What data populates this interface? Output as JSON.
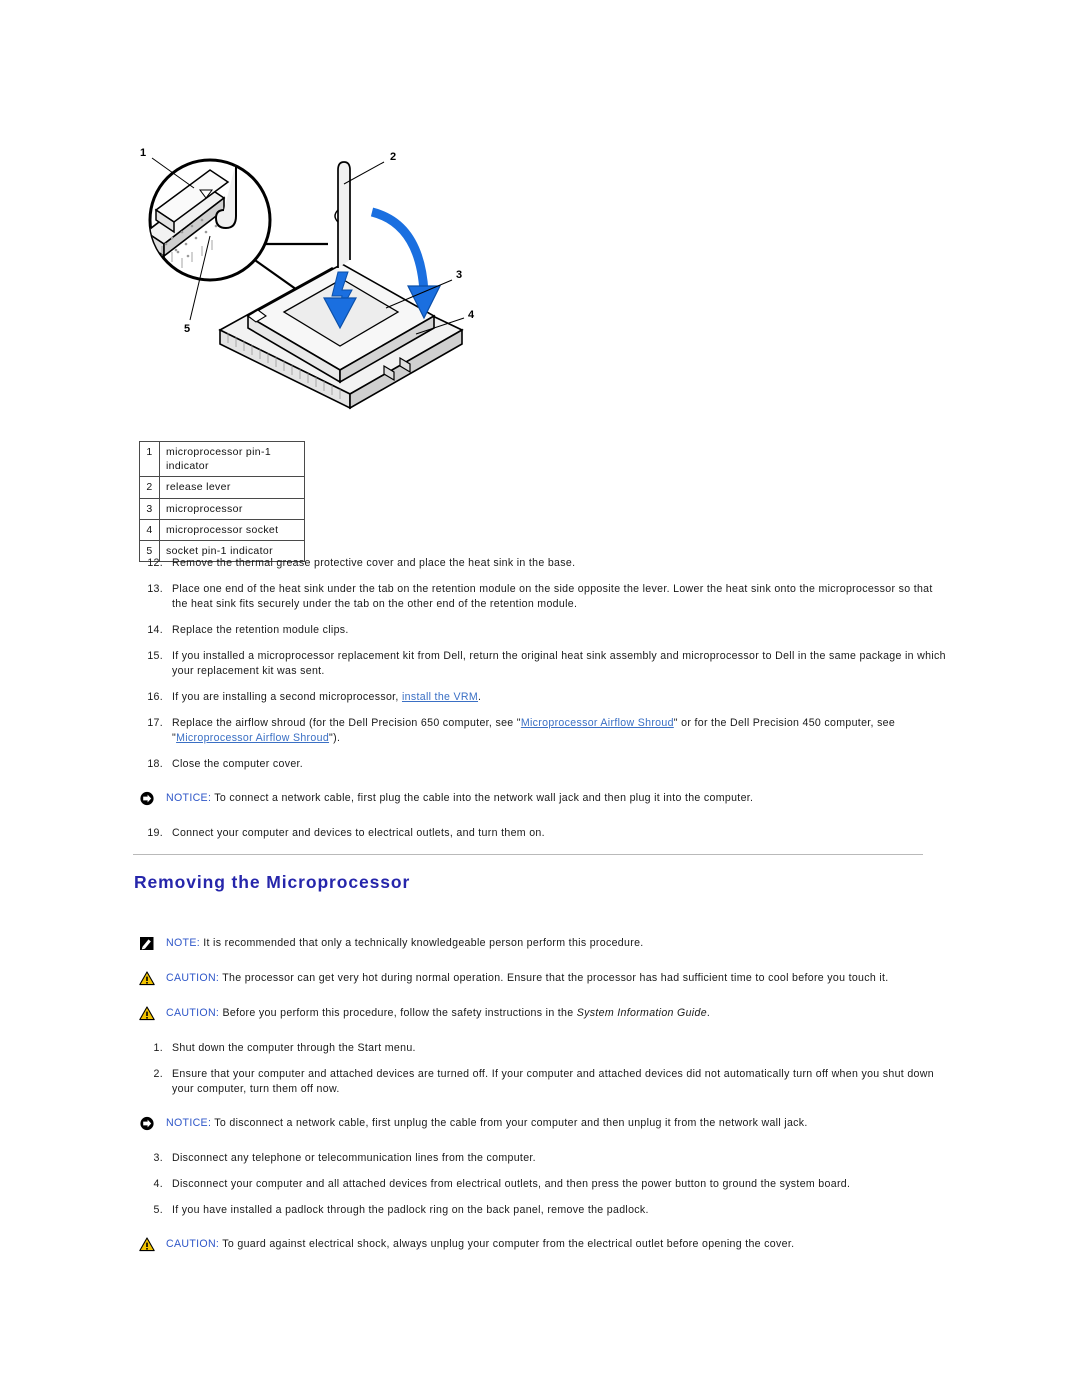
{
  "figure": {
    "name": "microprocessor-installation-diagram",
    "callouts": [
      "1",
      "2",
      "3",
      "4",
      "5"
    ],
    "accent_blue": "#1a6fe0"
  },
  "legend": {
    "name": "figure-legend",
    "rows": [
      {
        "num": "1",
        "label": "microprocessor pin-1 indicator"
      },
      {
        "num": "2",
        "label": "release lever"
      },
      {
        "num": "3",
        "label": "microprocessor"
      },
      {
        "num": "4",
        "label": "microprocessor socket"
      },
      {
        "num": "5",
        "label": "socket pin-1 indicator"
      }
    ]
  },
  "install_steps": [
    {
      "num": "12.",
      "text": "Remove the thermal grease protective cover and place the heat sink in the base."
    },
    {
      "num": "13.",
      "text": "Place one end of the heat sink under the tab on the retention module on the side opposite the lever. Lower the heat sink onto the microprocessor so that the heat sink fits securely under the tab on the other end of the retention module."
    },
    {
      "num": "14.",
      "text": "Replace the retention module clips."
    },
    {
      "num": "15.",
      "text": "If you installed a microprocessor replacement kit from Dell, return the original heat sink assembly and microprocessor to Dell in the same package in which your replacement kit was sent."
    }
  ],
  "step16": {
    "num": "16.",
    "prefix": "If you are installing a second microprocessor, ",
    "link": "install the VRM",
    "suffix": "."
  },
  "step17": {
    "num": "17.",
    "part1": "Replace the airflow shroud (for the Dell Precision 650 computer, see \"",
    "link1": "Microprocessor Airflow Shroud",
    "part2": "\" or for the Dell Precision 450 computer, see \"",
    "link2": "Microprocessor Airflow Shroud",
    "part3": "\")."
  },
  "step18": {
    "num": "18.",
    "text": "Close the computer cover."
  },
  "notice_connect": {
    "icon": "notice-icon",
    "label": "NOTICE:",
    "text": "To connect a network cable, first plug the cable into the network wall jack and then plug it into the computer."
  },
  "step19": {
    "num": "19.",
    "text": "Connect your computer and devices to electrical outlets, and turn them on."
  },
  "section": {
    "heading": "Removing the Microprocessor"
  },
  "note_block": {
    "icon": "note-icon",
    "label": "NOTE:",
    "text": "It is recommended that only a technically knowledgeable person perform this procedure."
  },
  "caution_hot": {
    "icon": "caution-icon",
    "label": "CAUTION:",
    "text": "The processor can get very hot during normal operation. Ensure that the processor has had sufficient time to cool before you touch it."
  },
  "caution_safety": {
    "icon": "caution-icon",
    "label": "CAUTION:",
    "prefix": "Before you perform this procedure, follow the safety instructions in the ",
    "italic": "System Information Guide",
    "suffix": "."
  },
  "remove_steps_a": [
    {
      "num": "1.",
      "text": "Shut down the computer through the Start menu."
    },
    {
      "num": "2.",
      "text": "Ensure that your computer and attached devices are turned off. If your computer and attached devices did not automatically turn off when you shut down your computer, turn them off now."
    }
  ],
  "notice_disconnect": {
    "icon": "notice-icon",
    "label": "NOTICE:",
    "text": "To disconnect a network cable, first unplug the cable from your computer and then unplug it from the network wall jack."
  },
  "remove_steps_b": [
    {
      "num": "3.",
      "text": "Disconnect any telephone or telecommunication lines from the computer."
    },
    {
      "num": "4.",
      "text": "Disconnect your computer and all attached devices from electrical outlets, and then press the power button to ground the system board."
    },
    {
      "num": "5.",
      "text": "If you have installed a padlock through the padlock ring on the back panel, remove the padlock."
    }
  ],
  "caution_shock": {
    "icon": "caution-icon",
    "label": "CAUTION:",
    "text": "To guard against electrical shock, always unplug your computer from the electrical outlet before opening the cover."
  }
}
